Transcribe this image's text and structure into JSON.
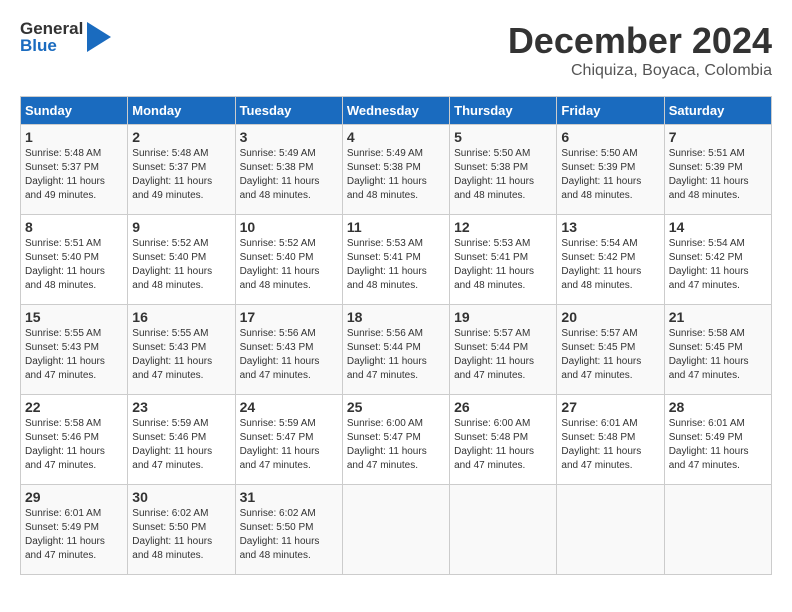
{
  "header": {
    "logo_general": "General",
    "logo_blue": "Blue",
    "month_title": "December 2024",
    "location": "Chiquiza, Boyaca, Colombia"
  },
  "days_of_week": [
    "Sunday",
    "Monday",
    "Tuesday",
    "Wednesday",
    "Thursday",
    "Friday",
    "Saturday"
  ],
  "weeks": [
    [
      {
        "day": "1",
        "sunrise": "5:48 AM",
        "sunset": "5:37 PM",
        "daylight": "11 hours and 49 minutes."
      },
      {
        "day": "2",
        "sunrise": "5:48 AM",
        "sunset": "5:37 PM",
        "daylight": "11 hours and 49 minutes."
      },
      {
        "day": "3",
        "sunrise": "5:49 AM",
        "sunset": "5:38 PM",
        "daylight": "11 hours and 48 minutes."
      },
      {
        "day": "4",
        "sunrise": "5:49 AM",
        "sunset": "5:38 PM",
        "daylight": "11 hours and 48 minutes."
      },
      {
        "day": "5",
        "sunrise": "5:50 AM",
        "sunset": "5:38 PM",
        "daylight": "11 hours and 48 minutes."
      },
      {
        "day": "6",
        "sunrise": "5:50 AM",
        "sunset": "5:39 PM",
        "daylight": "11 hours and 48 minutes."
      },
      {
        "day": "7",
        "sunrise": "5:51 AM",
        "sunset": "5:39 PM",
        "daylight": "11 hours and 48 minutes."
      }
    ],
    [
      {
        "day": "8",
        "sunrise": "5:51 AM",
        "sunset": "5:40 PM",
        "daylight": "11 hours and 48 minutes."
      },
      {
        "day": "9",
        "sunrise": "5:52 AM",
        "sunset": "5:40 PM",
        "daylight": "11 hours and 48 minutes."
      },
      {
        "day": "10",
        "sunrise": "5:52 AM",
        "sunset": "5:40 PM",
        "daylight": "11 hours and 48 minutes."
      },
      {
        "day": "11",
        "sunrise": "5:53 AM",
        "sunset": "5:41 PM",
        "daylight": "11 hours and 48 minutes."
      },
      {
        "day": "12",
        "sunrise": "5:53 AM",
        "sunset": "5:41 PM",
        "daylight": "11 hours and 48 minutes."
      },
      {
        "day": "13",
        "sunrise": "5:54 AM",
        "sunset": "5:42 PM",
        "daylight": "11 hours and 48 minutes."
      },
      {
        "day": "14",
        "sunrise": "5:54 AM",
        "sunset": "5:42 PM",
        "daylight": "11 hours and 47 minutes."
      }
    ],
    [
      {
        "day": "15",
        "sunrise": "5:55 AM",
        "sunset": "5:43 PM",
        "daylight": "11 hours and 47 minutes."
      },
      {
        "day": "16",
        "sunrise": "5:55 AM",
        "sunset": "5:43 PM",
        "daylight": "11 hours and 47 minutes."
      },
      {
        "day": "17",
        "sunrise": "5:56 AM",
        "sunset": "5:43 PM",
        "daylight": "11 hours and 47 minutes."
      },
      {
        "day": "18",
        "sunrise": "5:56 AM",
        "sunset": "5:44 PM",
        "daylight": "11 hours and 47 minutes."
      },
      {
        "day": "19",
        "sunrise": "5:57 AM",
        "sunset": "5:44 PM",
        "daylight": "11 hours and 47 minutes."
      },
      {
        "day": "20",
        "sunrise": "5:57 AM",
        "sunset": "5:45 PM",
        "daylight": "11 hours and 47 minutes."
      },
      {
        "day": "21",
        "sunrise": "5:58 AM",
        "sunset": "5:45 PM",
        "daylight": "11 hours and 47 minutes."
      }
    ],
    [
      {
        "day": "22",
        "sunrise": "5:58 AM",
        "sunset": "5:46 PM",
        "daylight": "11 hours and 47 minutes."
      },
      {
        "day": "23",
        "sunrise": "5:59 AM",
        "sunset": "5:46 PM",
        "daylight": "11 hours and 47 minutes."
      },
      {
        "day": "24",
        "sunrise": "5:59 AM",
        "sunset": "5:47 PM",
        "daylight": "11 hours and 47 minutes."
      },
      {
        "day": "25",
        "sunrise": "6:00 AM",
        "sunset": "5:47 PM",
        "daylight": "11 hours and 47 minutes."
      },
      {
        "day": "26",
        "sunrise": "6:00 AM",
        "sunset": "5:48 PM",
        "daylight": "11 hours and 47 minutes."
      },
      {
        "day": "27",
        "sunrise": "6:01 AM",
        "sunset": "5:48 PM",
        "daylight": "11 hours and 47 minutes."
      },
      {
        "day": "28",
        "sunrise": "6:01 AM",
        "sunset": "5:49 PM",
        "daylight": "11 hours and 47 minutes."
      }
    ],
    [
      {
        "day": "29",
        "sunrise": "6:01 AM",
        "sunset": "5:49 PM",
        "daylight": "11 hours and 47 minutes."
      },
      {
        "day": "30",
        "sunrise": "6:02 AM",
        "sunset": "5:50 PM",
        "daylight": "11 hours and 48 minutes."
      },
      {
        "day": "31",
        "sunrise": "6:02 AM",
        "sunset": "5:50 PM",
        "daylight": "11 hours and 48 minutes."
      },
      null,
      null,
      null,
      null
    ]
  ]
}
